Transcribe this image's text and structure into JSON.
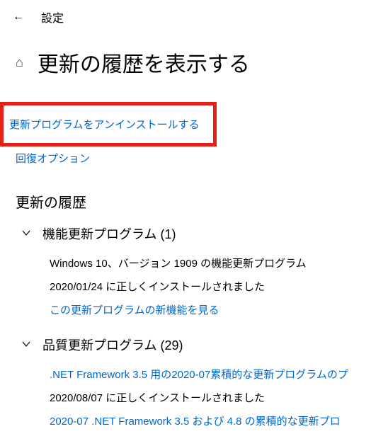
{
  "header": {
    "window_title": "設定"
  },
  "main": {
    "page_title": "更新の履歴を表示する",
    "uninstall_link": "更新プログラムをアンインストールする",
    "recovery_link": "回復オプション",
    "section_title": "更新の履歴",
    "categories": [
      {
        "title": "機能更新プログラム (1)",
        "items": [
          {
            "title": "Windows 10、バージョン 1909 の機能更新プログラム",
            "status": "2020/01/24 に正しくインストールされました",
            "link": "この更新プログラムの新機能を見る"
          }
        ]
      },
      {
        "title": "品質更新プログラム (29)",
        "items": [
          {
            "title": ".NET Framework 3.5 用の2020-07累積的な更新プログラムのプ",
            "status": "2020/08/07 に正しくインストールされました",
            "link": "2020-07 .NET Framework 3.5 および 4.8 の累積的な更新プロ"
          }
        ]
      }
    ]
  }
}
